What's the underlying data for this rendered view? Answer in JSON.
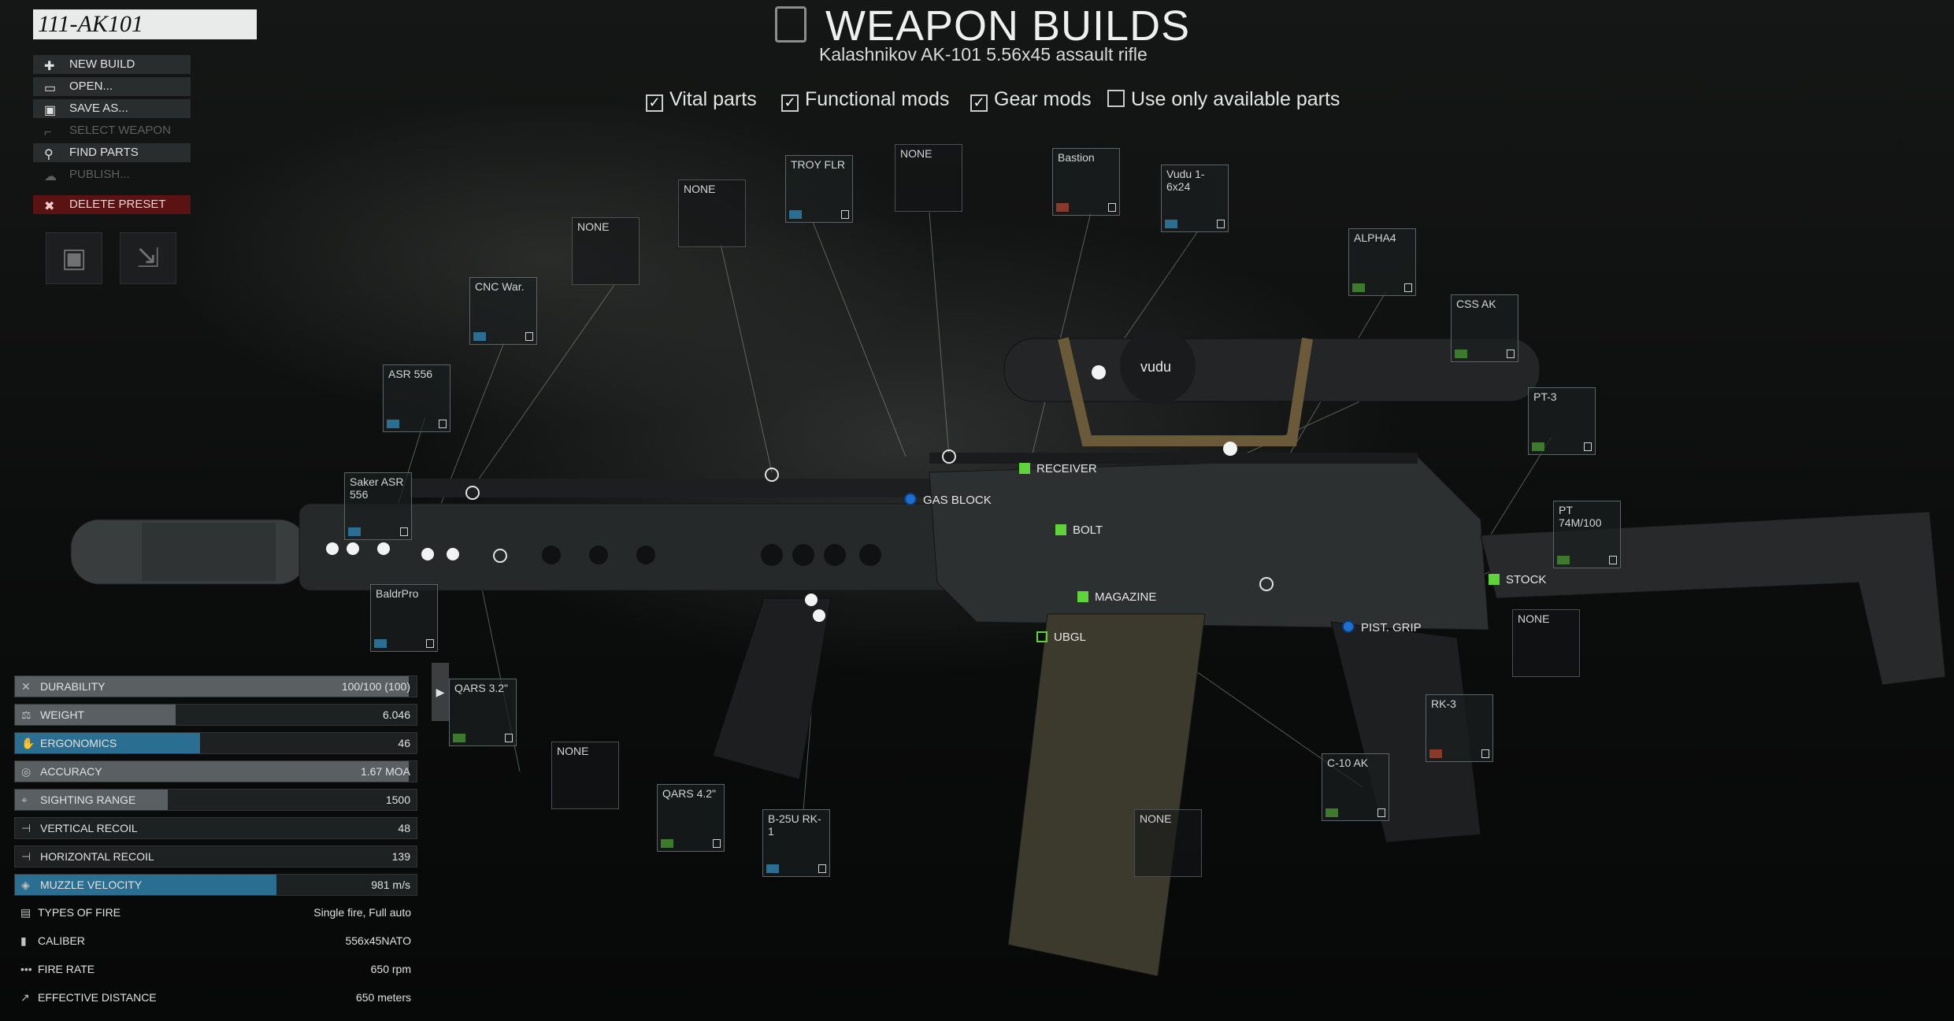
{
  "preset_name": "111-AK101",
  "menu": [
    {
      "label": "NEW BUILD",
      "icon": "new-build-icon",
      "enabled": true
    },
    {
      "label": "OPEN...",
      "icon": "folder-icon",
      "enabled": true
    },
    {
      "label": "SAVE AS...",
      "icon": "save-icon",
      "enabled": true
    },
    {
      "label": "SELECT WEAPON",
      "icon": "weapon-icon",
      "enabled": false
    },
    {
      "label": "FIND PARTS",
      "icon": "search-icon",
      "enabled": true
    },
    {
      "label": "PUBLISH...",
      "icon": "cloud-icon",
      "enabled": false
    },
    {
      "label": "DELETE PRESET",
      "icon": "delete-icon",
      "enabled": true
    }
  ],
  "header": {
    "title": "WEAPON BUILDS",
    "subtitle": "Kalashnikov AK-101 5.56x45 assault rifle"
  },
  "filters": [
    {
      "label": "Vital parts",
      "checked": true
    },
    {
      "label": "Functional mods",
      "checked": true
    },
    {
      "label": "Gear mods",
      "checked": true
    },
    {
      "label": "Use only available parts",
      "checked": false
    }
  ],
  "slots": [
    {
      "name": "TROY FLR"
    },
    {
      "name": "NONE"
    },
    {
      "name": "Bastion"
    },
    {
      "name": "Vudu 1-6x24"
    },
    {
      "name": "NONE"
    },
    {
      "name": "NONE"
    },
    {
      "name": "CNC War."
    },
    {
      "name": "ASR 556"
    },
    {
      "name": "Saker ASR 556"
    },
    {
      "name": "BaldrPro"
    },
    {
      "name": "ALPHA4"
    },
    {
      "name": "CSS AK"
    },
    {
      "name": "PT-3"
    },
    {
      "name": "PT 74M/100"
    },
    {
      "name": "NONE"
    },
    {
      "name": "RK-3"
    },
    {
      "name": "C-10 AK"
    },
    {
      "name": "NONE"
    },
    {
      "name": "QARS 3.2\""
    },
    {
      "name": "NONE"
    },
    {
      "name": "QARS 4.2\""
    },
    {
      "name": "B-25U RK-1"
    }
  ],
  "mount_labels": [
    "RECEIVER",
    "GAS BLOCK",
    "BOLT",
    "MAGAZINE",
    "UBGL",
    "PIST. GRIP",
    "STOCK"
  ],
  "scope_brand": "vudu",
  "stats": [
    {
      "name": "DURABILITY",
      "value": "100/100 (100)",
      "bar": 0.98
    },
    {
      "name": "WEIGHT",
      "value": "6.046",
      "bar": 0.4
    },
    {
      "name": "ERGONOMICS",
      "value": "46",
      "bar": 0.46
    },
    {
      "name": "ACCURACY",
      "value": "1.67 MOA",
      "bar": 0.98
    },
    {
      "name": "SIGHTING RANGE",
      "value": "1500",
      "bar": 0.38
    },
    {
      "name": "VERTICAL RECOIL",
      "value": "48"
    },
    {
      "name": "HORIZONTAL RECOIL",
      "value": "139"
    },
    {
      "name": "MUZZLE VELOCITY",
      "value": "981 m/s",
      "bar": 0.65
    },
    {
      "name": "TYPES OF FIRE",
      "value": "Single fire, Full auto"
    },
    {
      "name": "CALIBER",
      "value": "556x45NATO"
    },
    {
      "name": "FIRE RATE",
      "value": "650 rpm"
    },
    {
      "name": "EFFECTIVE DISTANCE",
      "value": "650 meters"
    }
  ],
  "colors": {
    "accent_green": "#5fd43a",
    "accent_blue": "#1f6fd0",
    "delete_red": "#5a1212",
    "ergonomics_bar": "#2a6f92"
  }
}
